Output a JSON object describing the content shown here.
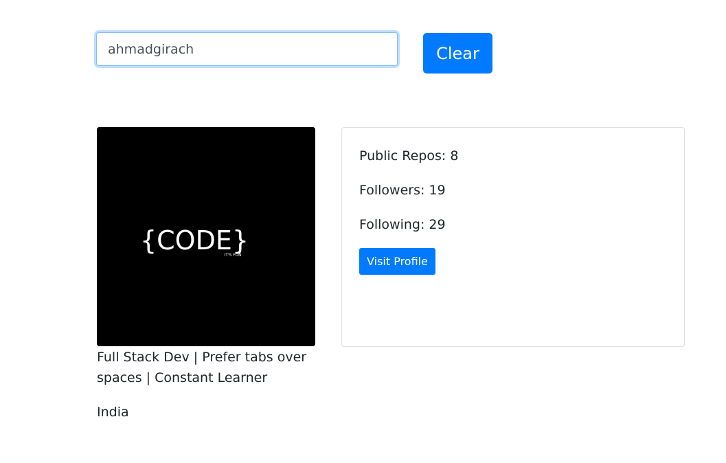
{
  "search": {
    "value": "ahmadgirach",
    "clear_label": "Clear"
  },
  "profile": {
    "avatar": {
      "logo_text": "{CODE}",
      "logo_subtext": "IT'S FUN"
    },
    "bio": "Full Stack Dev | Prefer tabs over spaces | Constant Learner",
    "location": "India"
  },
  "stats": {
    "public_repos": "Public Repos: 8",
    "followers": "Followers: 19",
    "following": "Following: 29",
    "visit_label": "Visit Profile"
  },
  "colors": {
    "accent": "#007bff",
    "avatar_bg": "#000000",
    "text": "#212529"
  }
}
